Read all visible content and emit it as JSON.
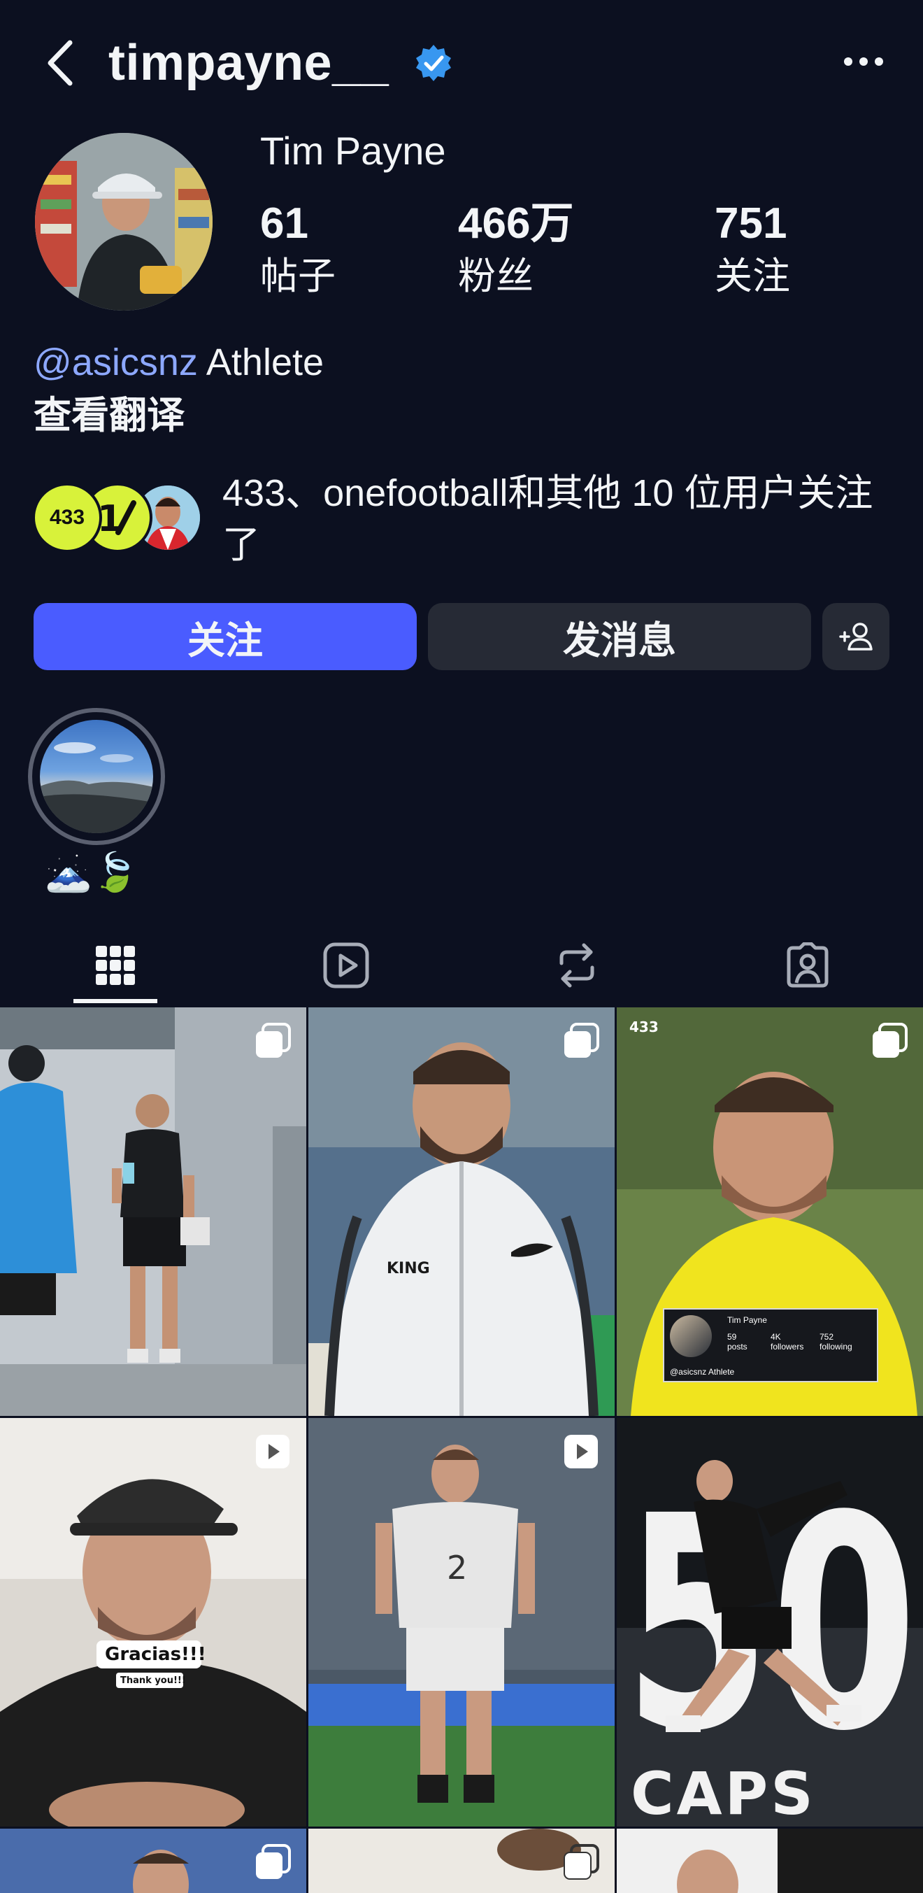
{
  "header": {
    "username": "timpayne__",
    "verified": true,
    "back_icon": "chevron-left-icon",
    "more_icon": "more-dots-icon"
  },
  "profile": {
    "display_name": "Tim Payne",
    "stats": [
      {
        "value": "61",
        "label": "帖子"
      },
      {
        "value": "466万",
        "label": "粉丝"
      },
      {
        "value": "751",
        "label": "关注"
      }
    ],
    "bio_mention": "@asicsnz",
    "bio_text": " Athlete",
    "translate_label": "查看翻译",
    "followed_by_text": "433、onefootball和其他 10 位用户关注了",
    "followed_by_avatars": [
      "433",
      "onefootball",
      "user"
    ]
  },
  "buttons": {
    "follow": "关注",
    "message": "发消息",
    "suggest_icon": "add-person-icon"
  },
  "highlights": [
    {
      "label": "🗻🍃"
    }
  ],
  "tabs": [
    {
      "name": "posts",
      "icon": "grid-icon",
      "active": true
    },
    {
      "name": "reels",
      "icon": "play-icon",
      "active": false
    },
    {
      "name": "reposts",
      "icon": "repost-icon",
      "active": false
    },
    {
      "name": "tagged",
      "icon": "tagged-person-icon",
      "active": false
    }
  ],
  "posts": [
    {
      "badge": "carousel-icon"
    },
    {
      "badge": "carousel-icon"
    },
    {
      "badge": "carousel-icon",
      "overlay_watermark": "433",
      "overlay_name": "Tim Payne",
      "overlay_stats": [
        "59",
        "posts",
        "4K",
        "followers",
        "752",
        "following"
      ],
      "overlay_bio": "@asicsnz Athlete"
    },
    {
      "badge": "reel-icon",
      "caption_1": "Gracias!!!",
      "caption_2": "Thank you!!!"
    },
    {
      "badge": "reel-icon",
      "jersey_number": "2"
    },
    {
      "badge": "",
      "big_number": "50",
      "bottom_text": "CAPS"
    },
    {
      "badge": "carousel-icon"
    },
    {
      "badge": "carousel-icon"
    },
    {
      "badge": ""
    }
  ],
  "colors": {
    "background": "#0c1020",
    "accent": "#4a5cff",
    "verified": "#3897f0",
    "mention": "#8da8ff"
  }
}
